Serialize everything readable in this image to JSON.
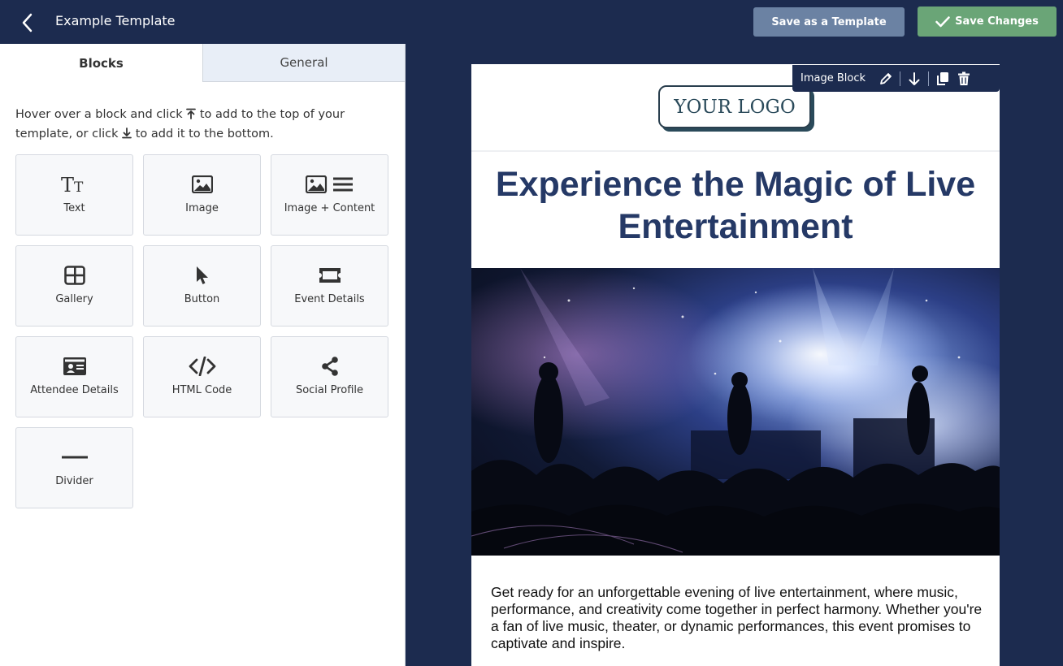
{
  "header": {
    "title": "Example Template",
    "save_template_label": "Save as a Template",
    "save_changes_label": "Save Changes"
  },
  "tabs": [
    {
      "label": "Blocks",
      "active": true
    },
    {
      "label": "General",
      "active": false
    }
  ],
  "hint": {
    "part1": "Hover over a block and click",
    "part2": "to add to the top of your template, or click",
    "part3": "to add it to the bottom."
  },
  "blocks": [
    {
      "label": "Text",
      "icon": "text-icon"
    },
    {
      "label": "Image",
      "icon": "image-icon"
    },
    {
      "label": "Image + Content",
      "icon": "image-content-icon"
    },
    {
      "label": "Gallery",
      "icon": "gallery-icon"
    },
    {
      "label": "Button",
      "icon": "pointer-icon"
    },
    {
      "label": "Event Details",
      "icon": "ticket-icon"
    },
    {
      "label": "Attendee Details",
      "icon": "id-card-icon"
    },
    {
      "label": "HTML Code",
      "icon": "code-icon"
    },
    {
      "label": "Social Profile",
      "icon": "share-icon"
    },
    {
      "label": "Divider",
      "icon": "divider-icon"
    }
  ],
  "toolbar": {
    "label": "Image Block"
  },
  "email": {
    "logo_text": "YOUR LOGO",
    "headline": "Experience the Magic of Live Entertainment",
    "body": "Get ready for an unforgettable evening of live entertainment, where music, performance, and creativity come together in perfect harmony. Whether you're a fan of live music, theater, or dynamic performances, this event promises to captivate and inspire."
  },
  "colors": {
    "nav_bg": "#1c2b4f",
    "save_green": "#6aa577",
    "template_btn": "#6b82a3",
    "headline": "#253966"
  }
}
